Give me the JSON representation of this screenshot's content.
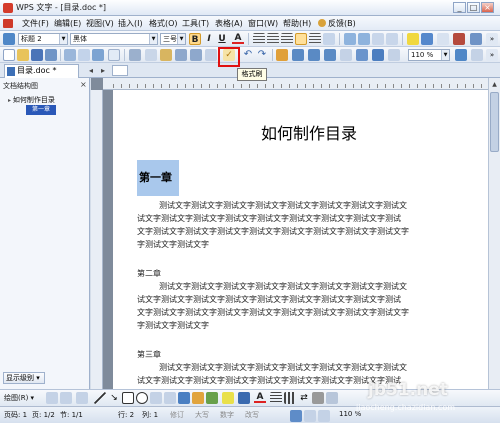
{
  "window": {
    "title": "WPS 文字 - [目录.doc *]",
    "controls": [
      "_",
      "□",
      "×"
    ]
  },
  "menubar": {
    "items": [
      "文件(F)",
      "编辑(E)",
      "视图(V)",
      "插入(I)",
      "格式(O)",
      "工具(T)",
      "表格(A)",
      "窗口(W)",
      "帮助(H)",
      "反馈(B)"
    ]
  },
  "format_toolbar": {
    "style_value": "标题 2",
    "font_value": "黑体",
    "size_value": "三号",
    "bold": "B",
    "italic": "I",
    "underline": "U",
    "font_color": "A"
  },
  "standard_toolbar": {
    "zoom_value": "110 %",
    "tooltip": "格式刷"
  },
  "tabs": {
    "doc_tab": "目录.doc *"
  },
  "side_panel": {
    "title": "文档结构图",
    "close": "×",
    "outline": [
      {
        "label": "如何制作目录",
        "level": 1
      },
      {
        "label": "第一章",
        "level": 2,
        "selected": true
      }
    ],
    "level_button": "显示级别 ▾"
  },
  "document": {
    "title": "如何制作目录",
    "chapter1": "第一章",
    "para1": [
      "测试文字测试文字测试文字测试文字测试文字测试文字测试文字测试文",
      "试文字测试文字测试文字测试文字测试文字测试文字测试文字测试文字测试",
      "文字测试文字测试文字测试文字测试文字测试文字测试文字测试文字测试文字",
      "字测试文字测试文字"
    ],
    "chapter2": "第二章",
    "para2": [
      "测试文字测试文字测试文字测试文字测试文字测试文字测试文字测试文",
      "试文字测试文字测试文字测试文字测试文字测试文字测试文字测试文字测试",
      "文字测试文字测试文字测试文字测试文字测试文字测试文字测试文字测试文字",
      "字测试文字测试文字"
    ],
    "chapter3": "第三章",
    "para3": [
      "测试文字测试文字测试文字测试文字测试文字测试文字测试文字测试文",
      "试文字测试文字测试文字测试文字测试文字测试文字测试文字测试文字测试"
    ]
  },
  "drawbar": {
    "draw_label": "绘图(R) ▾",
    "autoshape": "A"
  },
  "statusbar": {
    "page": "页码: 1",
    "pages": "页: 1/2",
    "section": "节: 1/1",
    "row": "行: 2",
    "col": "列: 1",
    "rev": "修订",
    "caps": "大写",
    "num": "数字",
    "ovr": "改写",
    "zoom": "110 %"
  },
  "watermark": {
    "text": "jb51.net",
    "sub": "jiaocheng.chazidian.com"
  }
}
